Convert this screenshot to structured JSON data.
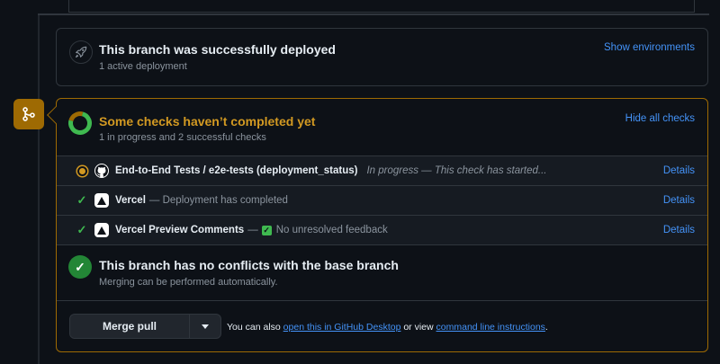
{
  "deployment": {
    "title": "This branch was successfully deployed",
    "subtitle": "1 active deployment",
    "show_environments": "Show environments"
  },
  "checks": {
    "title": "Some checks haven’t completed yet",
    "subtitle": "1 in progress and 2 successful checks",
    "hide_all": "Hide all checks",
    "items": [
      {
        "status": "in-progress",
        "app": "github",
        "name": "End-to-End Tests / e2e-tests (deployment_status)",
        "description": "In progress — This check has started...",
        "details": "Details"
      },
      {
        "status": "success",
        "app": "vercel",
        "name": "Vercel",
        "description": "— Deployment has completed",
        "details": "Details"
      },
      {
        "status": "success",
        "app": "vercel",
        "name": "Vercel Preview Comments",
        "description_prefix": "—",
        "description": "No unresolved feedback",
        "details": "Details"
      }
    ]
  },
  "conflicts": {
    "title": "This branch has no conflicts with the base branch",
    "subtitle": "Merging can be performed automatically."
  },
  "merge": {
    "button_label": "Merge pull request",
    "footer_prefix": "You can also",
    "desktop_link": "open this in GitHub Desktop",
    "footer_middle": "or view",
    "cli_link": "command line instructions",
    "footer_suffix": "."
  },
  "colors": {
    "background": "#0d1117",
    "border": "#30363d",
    "link": "#4493f8",
    "success": "#3fb950",
    "pending": "#d29922",
    "merge_badge": "#9e6a03"
  }
}
